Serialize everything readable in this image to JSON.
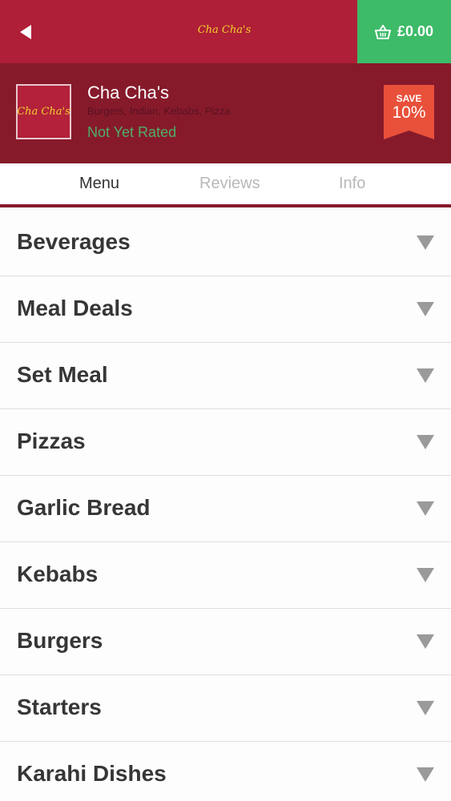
{
  "header": {
    "back_icon": "back-arrow-icon",
    "logo_text": "Cha Cha's",
    "basket": {
      "icon": "basket-icon",
      "total": "£0.00"
    }
  },
  "restaurant": {
    "logo_text": "Cha Cha's",
    "name": "Cha Cha's",
    "cuisines": "Burgers, Indian, Kebabs, Pizza",
    "rating": "Not Yet Rated",
    "save_badge": {
      "label": "SAVE",
      "value": "10%"
    }
  },
  "tabs": [
    {
      "label": "Menu",
      "active": true
    },
    {
      "label": "Reviews",
      "active": false
    },
    {
      "label": "Info",
      "active": false
    }
  ],
  "categories": [
    {
      "label": "Beverages"
    },
    {
      "label": "Meal Deals"
    },
    {
      "label": "Set Meal"
    },
    {
      "label": "Pizzas"
    },
    {
      "label": "Garlic Bread"
    },
    {
      "label": "Kebabs"
    },
    {
      "label": "Burgers"
    },
    {
      "label": "Starters"
    },
    {
      "label": "Karahi Dishes"
    }
  ],
  "colors": {
    "header_red": "#af1f37",
    "dark_red": "#861a2b",
    "basket_green": "#3dbb68",
    "rating_green": "#4fae67",
    "save_badge": "#e8503a"
  }
}
